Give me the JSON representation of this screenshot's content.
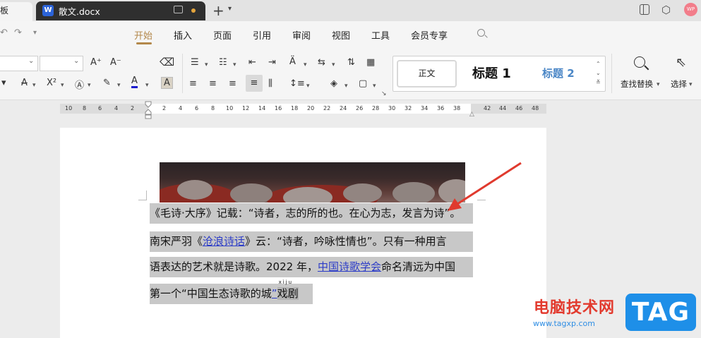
{
  "titlebar": {
    "prev_tab": "板",
    "doc_tab": "散文.docx",
    "avatar": "WP"
  },
  "menu": {
    "items": [
      "开始",
      "插入",
      "页面",
      "引用",
      "审阅",
      "视图",
      "工具",
      "会员专享"
    ],
    "active": "开始"
  },
  "toolbar": {
    "styles": {
      "normal": "正文",
      "h1": "标题 1",
      "h2": "标题 2"
    },
    "find_replace": "查找替换",
    "select": "选择",
    "icons": {
      "grow_font": "A⁺",
      "shrink_font": "A⁻",
      "clear_format": "eraser-icon",
      "bold": "",
      "superscript": "X²",
      "font_color_letter": "A",
      "char_shading_letter": "A",
      "strike": "A"
    }
  },
  "ruler": {
    "left_numbers": [
      "10",
      "8",
      "6",
      "4",
      "2"
    ],
    "right_numbers": [
      "2",
      "4",
      "6",
      "8",
      "10",
      "12",
      "14",
      "16",
      "18",
      "20",
      "22",
      "24",
      "26",
      "28",
      "30",
      "32",
      "34",
      "36",
      "38"
    ],
    "far_numbers": [
      "42",
      "44",
      "46",
      "48"
    ]
  },
  "document": {
    "lines": {
      "l1": "《毛诗·大序》记载：“诗者，志的所的也。在心为志，发言为诗”。",
      "l2_pre": "南宋严羽《",
      "l2_link": "沧浪诗话",
      "l2_post": "》云：“诗者，吟咏性情也”。只有一种用言",
      "l3_pre": "语表达的艺术就是诗歌。2022 年，",
      "l3_link": "中国诗歌学会",
      "l3_post": "命名清远为中国",
      "l4_pre": "第一个“中国生态诗歌的城",
      "l4_quote": "”",
      "l4_ruby": "xìju",
      "l4_post": "戏剧"
    }
  },
  "watermark": {
    "site": "电脑技术网",
    "url": "www.tagxp.com",
    "logo": "TAG"
  },
  "colors": {
    "accent": "#b3884a",
    "link": "#2c3cc7",
    "selection": "#c8c8c8",
    "arrow": "#e03a2e"
  }
}
